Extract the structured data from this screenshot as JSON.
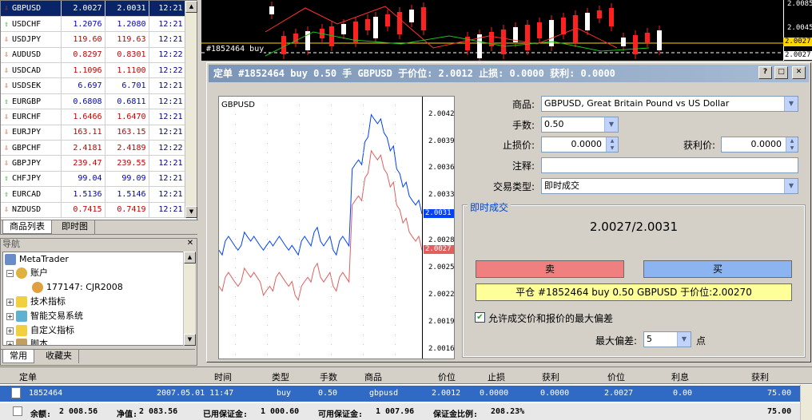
{
  "market_watch": {
    "rows": [
      {
        "symbol": "GBPUSD",
        "bid": "2.0027",
        "ask": "2.0031",
        "time": "12:21",
        "dir": "down",
        "color": "blue"
      },
      {
        "symbol": "USDCHF",
        "bid": "1.2076",
        "ask": "1.2080",
        "time": "12:21",
        "dir": "up",
        "color": "blue"
      },
      {
        "symbol": "USDJPY",
        "bid": "119.60",
        "ask": "119.63",
        "time": "12:21",
        "dir": "down",
        "color": "red"
      },
      {
        "symbol": "AUDUSD",
        "bid": "0.8297",
        "ask": "0.8301",
        "time": "12:22",
        "dir": "down",
        "color": "red"
      },
      {
        "symbol": "USDCAD",
        "bid": "1.1096",
        "ask": "1.1100",
        "time": "12:22",
        "dir": "down",
        "color": "red"
      },
      {
        "symbol": "USDSEK",
        "bid": "6.697",
        "ask": "6.701",
        "time": "12:21",
        "dir": "down",
        "color": "blue"
      },
      {
        "symbol": "EURGBP",
        "bid": "0.6808",
        "ask": "0.6811",
        "time": "12:21",
        "dir": "up",
        "color": "blue"
      },
      {
        "symbol": "EURCHF",
        "bid": "1.6466",
        "ask": "1.6470",
        "time": "12:21",
        "dir": "down",
        "color": "red"
      },
      {
        "symbol": "EURJPY",
        "bid": "163.11",
        "ask": "163.15",
        "time": "12:21",
        "dir": "down",
        "color": "red"
      },
      {
        "symbol": "GBPCHF",
        "bid": "2.4181",
        "ask": "2.4189",
        "time": "12:22",
        "dir": "down",
        "color": "red"
      },
      {
        "symbol": "GBPJPY",
        "bid": "239.47",
        "ask": "239.55",
        "time": "12:21",
        "dir": "down",
        "color": "red"
      },
      {
        "symbol": "CHFJPY",
        "bid": "99.04",
        "ask": "99.09",
        "time": "12:21",
        "dir": "up",
        "color": "blue"
      },
      {
        "symbol": "EURCAD",
        "bid": "1.5136",
        "ask": "1.5146",
        "time": "12:21",
        "dir": "up",
        "color": "blue"
      },
      {
        "symbol": "NZDUSD",
        "bid": "0.7415",
        "ask": "0.7419",
        "time": "12:21",
        "dir": "down",
        "color": "red"
      }
    ],
    "tabs": [
      "商品列表",
      "即时图"
    ]
  },
  "navigator": {
    "title": "导航",
    "root": "MetaTrader",
    "account_folder": "账户",
    "account": "177147: CJR2008",
    "items": [
      "技术指标",
      "智能交易系统",
      "自定义指标",
      "脚本"
    ],
    "tabs": [
      "常用",
      "收藏夹"
    ]
  },
  "background_chart": {
    "order_label": "#1852464 buy",
    "prices": [
      "2.0085",
      "2.0045",
      "2.0027",
      "2.0027"
    ]
  },
  "dialog": {
    "title": "定单 #1852464 buy 0.50 手 GBPUSD 于价位: 2.0012 止损: 0.0000 获利: 0.0000",
    "symbol_label": "商品:",
    "symbol_value": "GBPUSD, Great Britain Pound vs US Dollar",
    "volume_label": "手数:",
    "volume_value": "0.50",
    "sl_label": "止损价:",
    "sl_value": "0.0000",
    "tp_label": "获利价:",
    "tp_value": "0.0000",
    "comment_label": "注释:",
    "comment_value": "",
    "type_label": "交易类型:",
    "type_value": "即时成交",
    "group_label": "即时成交",
    "quote": "2.0027/2.0031",
    "sell_label": "卖",
    "buy_label": "买",
    "close_label": "平仓 #1852464 buy 0.50 GBPUSD 于价位:2.00270",
    "deviation_check_label": "允许成交价和报价的最大偏差",
    "deviation_checked": true,
    "max_dev_label": "最大偏差:",
    "max_dev_value": "5",
    "points_label": "点",
    "colors": {
      "sell": "#f08080",
      "buy": "#8cb4f0",
      "close": "#ffff99"
    }
  },
  "chart_data": {
    "type": "line",
    "title": "GBPUSD",
    "y_ticks": [
      "2.0042",
      "2.0039",
      "2.0036",
      "2.0033",
      "2.0031",
      "2.0028",
      "2.0027",
      "2.0025",
      "2.0022",
      "2.0019",
      "2.0016"
    ],
    "ylim": [
      2.0015,
      2.0044
    ],
    "series": [
      {
        "color": "#0040ff",
        "values": [
          2.0027,
          2.0028,
          2.0028,
          2.0027,
          2.0029,
          2.0028,
          2.0028,
          2.0027,
          2.0028,
          2.0028,
          2.0028,
          2.0027,
          2.0027,
          2.0028,
          2.0028,
          2.0029,
          2.0028,
          2.0028,
          2.0027,
          2.0028,
          2.0028,
          2.0036,
          2.0037,
          2.0039,
          2.0042,
          2.0041,
          2.004,
          2.0038,
          2.0036,
          2.0034,
          2.0033,
          2.0032,
          2.0031
        ]
      },
      {
        "color": "#e06060",
        "values": [
          2.0023,
          2.0024,
          2.0024,
          2.0023,
          2.0025,
          2.0024,
          2.0024,
          2.0022,
          2.0023,
          2.0024,
          2.0024,
          2.0023,
          2.0022,
          2.0023,
          2.0024,
          2.0025,
          2.0024,
          2.0024,
          2.0023,
          2.0024,
          2.0024,
          2.0032,
          2.0033,
          2.0035,
          2.0038,
          2.0037,
          2.0036,
          2.0034,
          2.0032,
          2.003,
          2.0029,
          2.0028,
          2.0027
        ]
      }
    ],
    "last_ask": "2.0031",
    "last_bid": "2.0027"
  },
  "terminal": {
    "headers": [
      "定单",
      "时间",
      "类型",
      "手数",
      "商品",
      "价位",
      "止损",
      "获利",
      "价位",
      "利息",
      "获利"
    ],
    "row": [
      "1852464",
      "2007.05.01 11:47",
      "buy",
      "0.50",
      "gbpusd",
      "2.0012",
      "0.0000",
      "0.0000",
      "2.0027",
      "0.00",
      "75.00"
    ],
    "summary": [
      {
        "label": "余额:",
        "value": "2 008.56"
      },
      {
        "label": "净值:",
        "value": "2 083.56"
      },
      {
        "label": "已用保证金:",
        "value": "1 000.60"
      },
      {
        "label": "可用保证金:",
        "value": "1 007.96"
      },
      {
        "label": "保证金比例:",
        "value": "208.23%"
      }
    ],
    "summary_profit": "75.00"
  }
}
